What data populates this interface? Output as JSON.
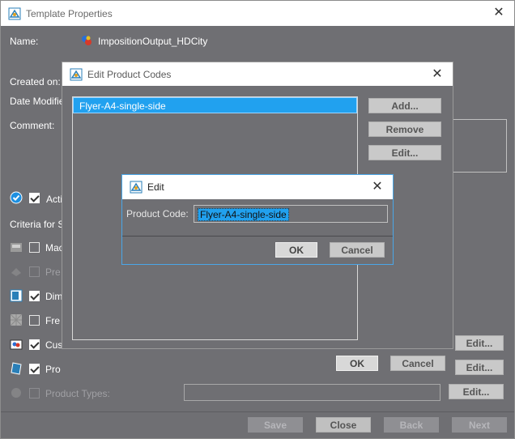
{
  "main": {
    "title": "Template Properties",
    "name_label": "Name:",
    "name_value": "ImpositionOutput_HDCity",
    "created_label": "Created on:",
    "modified_label": "Date Modifie",
    "comment_label": "Comment:",
    "active_label": "Acti",
    "criteria_label": "Criteria for S",
    "criteria": [
      {
        "label": "Mac",
        "checked": false,
        "enabled": true
      },
      {
        "label": "Pre",
        "checked": false,
        "enabled": false
      },
      {
        "label": "Dim",
        "checked": true,
        "enabled": true
      },
      {
        "label": "Fre",
        "checked": false,
        "enabled": true
      },
      {
        "label": "Cus",
        "checked": true,
        "enabled": true
      },
      {
        "label": "Pro",
        "checked": true,
        "enabled": true
      },
      {
        "label": "Product Types:",
        "checked": false,
        "enabled": false
      }
    ],
    "edit_label": "Edit...",
    "buttons": {
      "save": "Save",
      "close": "Close",
      "back": "Back",
      "next": "Next"
    }
  },
  "product_codes_dialog": {
    "title": "Edit Product Codes",
    "items": [
      "Flyer-A4-single-side"
    ],
    "add": "Add...",
    "remove": "Remove",
    "edit": "Edit...",
    "ok": "OK",
    "cancel": "Cancel"
  },
  "edit_dialog": {
    "title": "Edit",
    "field_label": "Product Code:",
    "field_value": "Flyer-A4-single-side",
    "ok": "OK",
    "cancel": "Cancel"
  },
  "colors": {
    "background": "#6f6f73",
    "selection": "#21a1ef",
    "focus_border": "#4aa6e8"
  }
}
